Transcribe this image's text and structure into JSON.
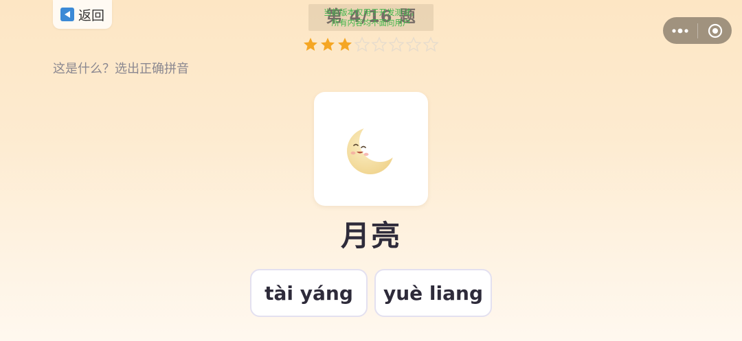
{
  "header": {
    "back_label": "返回",
    "progress_title": "第 4/16 题",
    "notice_line1": "当前版本仅用于开发测试，",
    "notice_line2": "所有内容均不面向用户"
  },
  "rating": {
    "filled": 3,
    "total": 8,
    "filled_color": "#f5a623",
    "empty_color": "#e6dccd"
  },
  "question": {
    "prompt": "这是什么？选出正确拼音"
  },
  "card": {
    "image_icon": "crescent-moon-icon",
    "word": "月亮"
  },
  "options": [
    {
      "label": "tài yáng"
    },
    {
      "label": "yuè liang"
    }
  ],
  "capsule": {
    "more_icon": "more-dots-icon",
    "close_icon": "target-close-icon"
  },
  "colors": {
    "accent_blue": "#3c8ad6",
    "notice_green": "#3fb54a",
    "text_dark": "#2e2b3a",
    "text_muted": "#8a8790"
  }
}
